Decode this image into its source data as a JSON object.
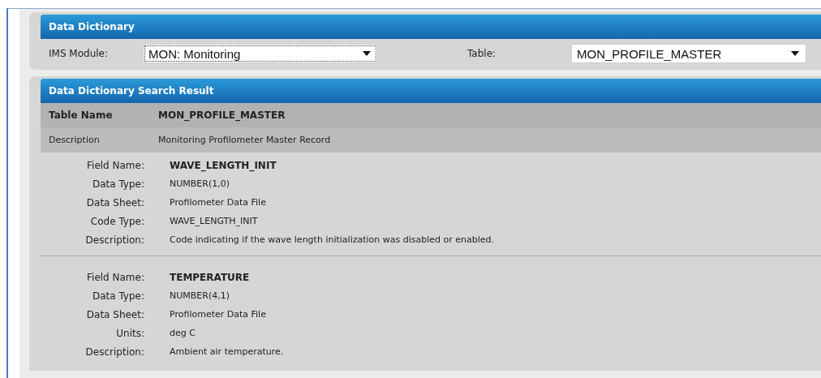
{
  "filter_panel": {
    "title": "Data Dictionary",
    "module": {
      "label": "IMS Module:",
      "value": "MON: Monitoring",
      "focused": true
    },
    "table": {
      "label": "Table:",
      "value": "MON_PROFILE_MASTER",
      "focused": false
    }
  },
  "result_panel": {
    "title": "Data Dictionary Search Result",
    "summary": [
      {
        "label": "Table Name",
        "value": "MON_PROFILE_MASTER",
        "kind": "name"
      },
      {
        "label": "Description",
        "value": "Monitoring Profilometer Master Record",
        "kind": "description"
      }
    ],
    "fields": [
      {
        "rows": [
          {
            "label": "Field Name:",
            "value": "WAVE_LENGTH_INIT",
            "kind": "name"
          },
          {
            "label": "Data Type:",
            "value": "NUMBER(1,0)",
            "kind": "plain"
          },
          {
            "label": "Data Sheet:",
            "value": "Profilometer Data File",
            "kind": "plain"
          },
          {
            "label": "Code Type:",
            "value": "WAVE_LENGTH_INIT",
            "kind": "plain"
          },
          {
            "label": "Description:",
            "value": "Code indicating if the wave length initialization was disabled or enabled.",
            "kind": "plain"
          }
        ]
      },
      {
        "rows": [
          {
            "label": "Field Name:",
            "value": "TEMPERATURE",
            "kind": "name"
          },
          {
            "label": "Data Type:",
            "value": "NUMBER(4,1)",
            "kind": "plain"
          },
          {
            "label": "Data Sheet:",
            "value": "Profilometer Data File",
            "kind": "plain"
          },
          {
            "label": "Units:",
            "value": "deg C",
            "kind": "plain"
          },
          {
            "label": "Description:",
            "value": "Ambient air temperature.",
            "kind": "plain"
          }
        ]
      }
    ]
  }
}
